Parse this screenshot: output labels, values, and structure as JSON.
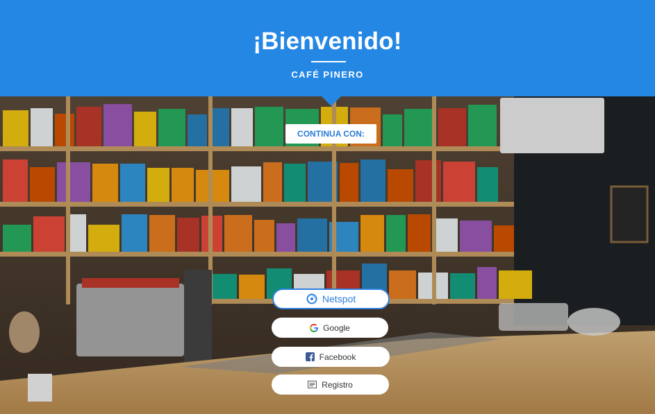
{
  "header": {
    "title": "¡Bienvenido!",
    "venue": "CAFÉ PINERO",
    "background_color": "#2487e4"
  },
  "continue_label": "CONTINUA CON:",
  "login_options": [
    {
      "id": "netspot",
      "label": "Netspot",
      "icon": "netspot-icon",
      "accent": "#2d7fe0"
    },
    {
      "id": "google",
      "label": "Google",
      "icon": "google-icon"
    },
    {
      "id": "facebook",
      "label": "Facebook",
      "icon": "facebook-icon",
      "accent": "#3b5998"
    },
    {
      "id": "registro",
      "label": "Registro",
      "icon": "form-icon"
    }
  ]
}
